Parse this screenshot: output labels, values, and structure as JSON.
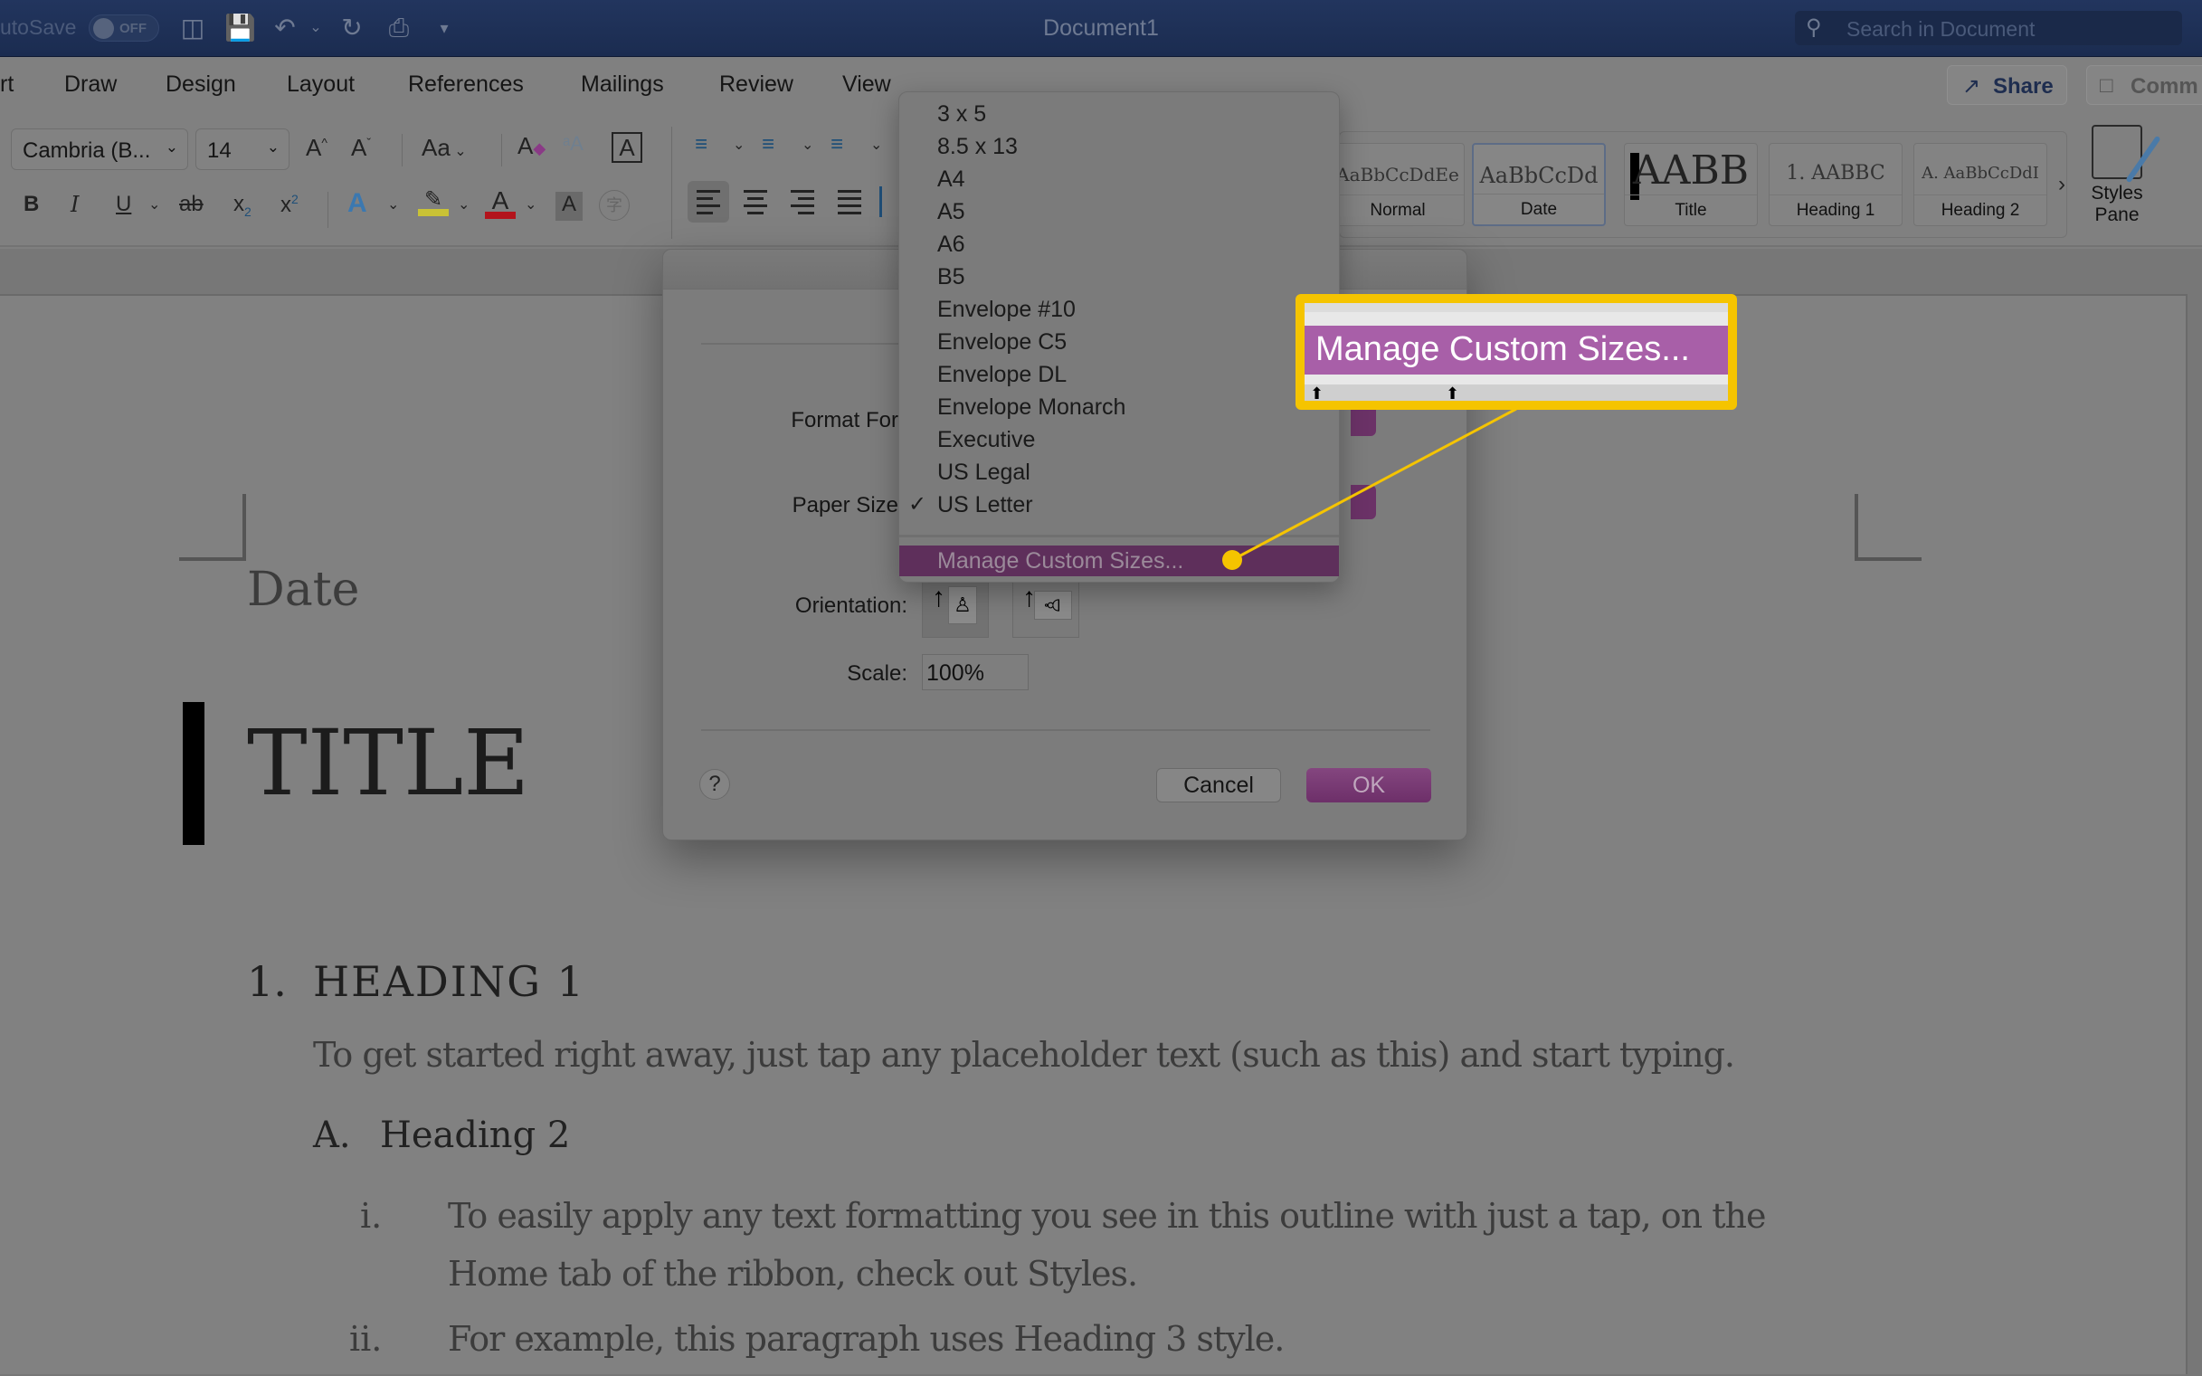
{
  "titlebar": {
    "autosave_label": "utoSave",
    "autosave_state": "OFF",
    "document_title": "Document1",
    "search_placeholder": "Search in Document",
    "quick_access_icons": [
      "sidebar-icon",
      "save-icon",
      "undo-icon",
      "redo-icon",
      "print-icon",
      "customize-icon"
    ]
  },
  "menu_tabs": [
    "rt",
    "Draw",
    "Design",
    "Layout",
    "References",
    "Mailings",
    "Review",
    "View"
  ],
  "header_buttons": {
    "share": "Share",
    "comments": "Comm"
  },
  "ribbon": {
    "font_name": "Cambria (B...",
    "font_size": "14",
    "format_buttons": {
      "bold": "B",
      "italic": "I",
      "underline": "U",
      "strikethrough": "ab",
      "subscript": "x",
      "superscript": "x"
    },
    "change_case": "Aa",
    "text_box_glyph": "A",
    "highlight_color": "#c9c236",
    "font_color": "#b3141c",
    "styles": [
      {
        "preview": "AaBbCcDdEe",
        "name": "Normal"
      },
      {
        "preview": "AaBbCcDd",
        "name": "Date",
        "selected": true
      },
      {
        "preview": "AABB",
        "name": "Title"
      },
      {
        "preview": "1. AABBC",
        "name": "Heading 1"
      },
      {
        "preview": "A. AaBbCcDdI",
        "name": "Heading 2"
      }
    ],
    "styles_pane_label_1": "Styles",
    "styles_pane_label_2": "Pane"
  },
  "document": {
    "date": "Date",
    "title": "TITLE",
    "heading1_num": "1.",
    "heading1": "HEADING 1",
    "body1": "To get started right away, just tap any placeholder text (such as this) and start typing.",
    "heading2_num": "A.",
    "heading2": "Heading 2",
    "list": [
      {
        "num": "i.",
        "line1": "To easily apply any text formatting you see in this outline with just a tap, on the",
        "line2": "Home tab of the ribbon, check out Styles."
      },
      {
        "num": "ii.",
        "line1": "For example, this paragraph uses Heading 3 style."
      }
    ]
  },
  "dialog": {
    "format_for_label": "Format For",
    "paper_size_label": "Paper Size",
    "orientation_label": "Orientation:",
    "scale_label": "Scale:",
    "scale_value": "100%",
    "help": "?",
    "cancel": "Cancel",
    "ok": "OK",
    "accent_color": "#7a3a76"
  },
  "paper_size_menu": {
    "items": [
      "3 x 5",
      "8.5 x 13",
      "A4",
      "A5",
      "A6",
      "B5",
      "Envelope #10",
      "Envelope C5",
      "Envelope DL",
      "Envelope Monarch",
      "Executive",
      "US Legal",
      "US Letter"
    ],
    "selected": "US Letter",
    "check_glyph": "✓",
    "manage_custom_sizes": "Manage Custom Sizes..."
  },
  "callout": {
    "text": "Manage Custom Sizes...",
    "border_color": "#f5c400",
    "highlight_color": "#a85fa8"
  }
}
